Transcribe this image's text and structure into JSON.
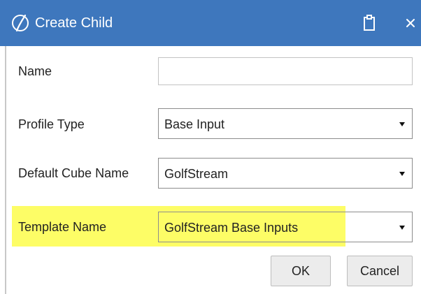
{
  "window": {
    "title": "Create Child",
    "logo_icon": "onestream-logo-icon",
    "actions": [
      {
        "name": "clipboard-icon",
        "glyph": "clipboard"
      },
      {
        "name": "close-icon",
        "glyph": "×"
      }
    ],
    "title_bar_color": "#3e77bd"
  },
  "form": {
    "name": {
      "label": "Name",
      "value": "",
      "placeholder": ""
    },
    "profile_type": {
      "label": "Profile Type",
      "value": "Base Input"
    },
    "default_cube_name": {
      "label": "Default Cube Name",
      "value": "GolfStream"
    },
    "template_name": {
      "label": "Template Name",
      "value": "GolfStream Base Inputs",
      "highlight_color": "#fdfd66"
    }
  },
  "buttons": {
    "ok_label": "OK",
    "cancel_label": "Cancel"
  }
}
